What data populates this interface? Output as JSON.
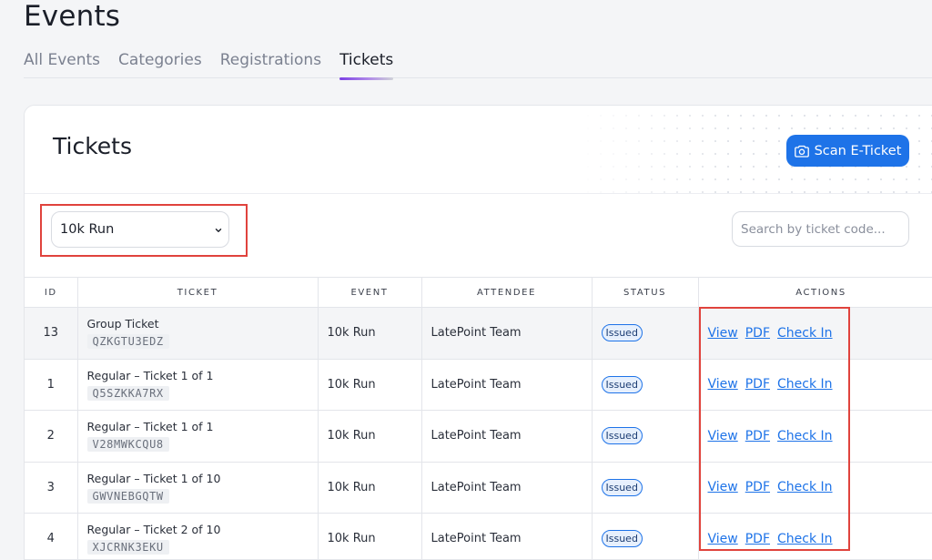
{
  "page": {
    "title": "Events"
  },
  "tabs": [
    {
      "label": "All Events"
    },
    {
      "label": "Categories"
    },
    {
      "label": "Registrations"
    },
    {
      "label": "Tickets"
    }
  ],
  "card": {
    "title": "Tickets",
    "scan_button_label": "Scan E-Ticket"
  },
  "filter": {
    "selected_event": "10k Run"
  },
  "search": {
    "placeholder": "Search by ticket code...",
    "value": ""
  },
  "table": {
    "headers": {
      "id": "ID",
      "ticket": "TICKET",
      "event": "EVENT",
      "attendee": "ATTENDEE",
      "status": "STATUS",
      "actions": "ACTIONS"
    },
    "action_labels": {
      "view": "View",
      "pdf": "PDF",
      "check_in": "Check In"
    },
    "rows": [
      {
        "id": "13",
        "ticket_name": "Group Ticket",
        "code": "QZKGTU3EDZ",
        "event": "10k Run",
        "attendee": "LatePoint Team",
        "status": "Issued"
      },
      {
        "id": "1",
        "ticket_name": "Regular – Ticket 1 of 1",
        "code": "Q5SZKKA7RX",
        "event": "10k Run",
        "attendee": "LatePoint Team",
        "status": "Issued"
      },
      {
        "id": "2",
        "ticket_name": "Regular – Ticket 1 of 1",
        "code": "V28MWKCQU8",
        "event": "10k Run",
        "attendee": "LatePoint Team",
        "status": "Issued"
      },
      {
        "id": "3",
        "ticket_name": "Regular – Ticket 1 of 10",
        "code": "GWVNEBGQTW",
        "event": "10k Run",
        "attendee": "LatePoint Team",
        "status": "Issued"
      },
      {
        "id": "4",
        "ticket_name": "Regular – Ticket 2 of 10",
        "code": "XJCRNK3EKU",
        "event": "10k Run",
        "attendee": "LatePoint Team",
        "status": "Issued"
      }
    ]
  },
  "colors": {
    "accent": "#1e73e8",
    "highlight": "#e0433d",
    "tab_indicator": "#7b3fe4"
  }
}
